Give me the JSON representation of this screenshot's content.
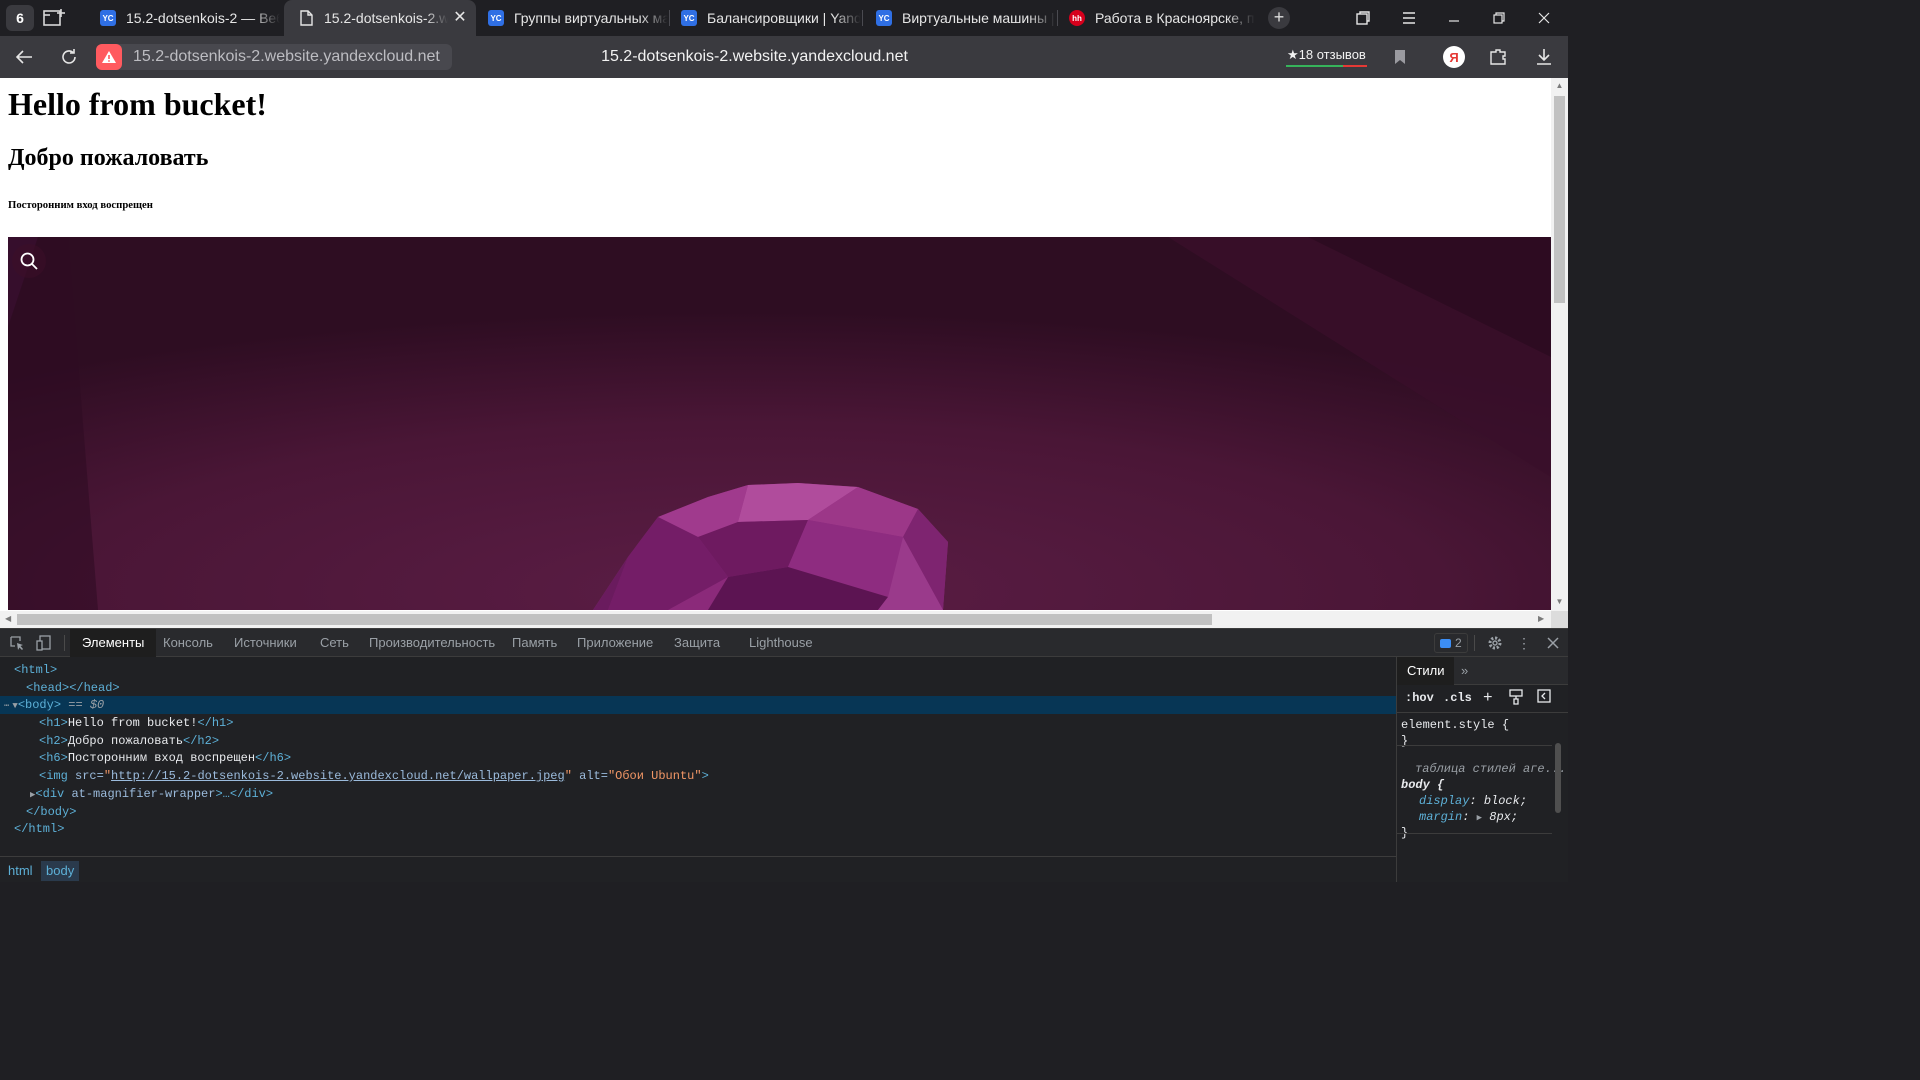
{
  "browser": {
    "tab_count": "6",
    "tabs": [
      {
        "title": "15.2-dotsenkois-2 — Веб",
        "favicon": "YC",
        "active": false
      },
      {
        "title": "15.2-dotsenkois-2.website.yandexcloud.net",
        "favicon": "page",
        "active": true
      },
      {
        "title": "Группы виртуальных машин",
        "favicon": "YC",
        "active": false
      },
      {
        "title": "Балансировщики | Yandex",
        "favicon": "YC",
        "active": false
      },
      {
        "title": "Виртуальные машины | Yandex",
        "favicon": "YC",
        "active": false
      },
      {
        "title": "Работа в Красноярске, п",
        "favicon": "hh",
        "active": false
      }
    ],
    "url": "15.2-dotsenkois-2.website.yandexcloud.net",
    "page_domain": "15.2-dotsenkois-2.website.yandexcloud.net",
    "reviews": "★18 отзывов",
    "yandex_letter": "Я"
  },
  "page": {
    "h1": "Hello from bucket!",
    "h2": "Добро пожаловать",
    "h6": "Посторонним вход воспрещен",
    "image_alt": "Обои Ubuntu"
  },
  "devtools": {
    "tabs": [
      "Элементы",
      "Консоль",
      "Источники",
      "Сеть",
      "Производительность",
      "Память",
      "Приложение",
      "Защита",
      "Lighthouse"
    ],
    "issues_count": "2",
    "dom": {
      "html_open": "<html>",
      "head": "<head></head>",
      "body_open": "<body>",
      "body_marker": " == $0",
      "h1_open": "<h1>",
      "h1_text": "Hello from bucket!",
      "h1_close": "</h1>",
      "h2_open": "<h2>",
      "h2_text": "Добро пожаловать",
      "h2_close": "</h2>",
      "h6_open": "<h6>",
      "h6_text": "Посторонним вход воспрещен",
      "h6_close": "</h6>",
      "img_open": "<img ",
      "img_src_attr": "src=",
      "img_src": "http://15.2-dotsenkois-2.website.yandexcloud.net/wallpaper.jpeg",
      "img_alt_attr": " alt=",
      "img_alt": "Обои Ubuntu",
      "img_close": ">",
      "div_open": "<div ",
      "div_attr": "at-magnifier-wrapper",
      "div_rest": ">…</div>",
      "body_close": "</body>",
      "html_close": "</html>"
    },
    "breadcrumbs": [
      "html",
      "body"
    ],
    "styles": {
      "tab": "Стили",
      "hov": ":hov",
      "cls": ".cls",
      "element_style": "element.style {",
      "close_brace": "}",
      "ua_title": "таблица стилей аге...",
      "selector": "body {",
      "display_prop": "display",
      "display_val": "block;",
      "margin_prop": "margin",
      "margin_val": "8px;"
    }
  }
}
